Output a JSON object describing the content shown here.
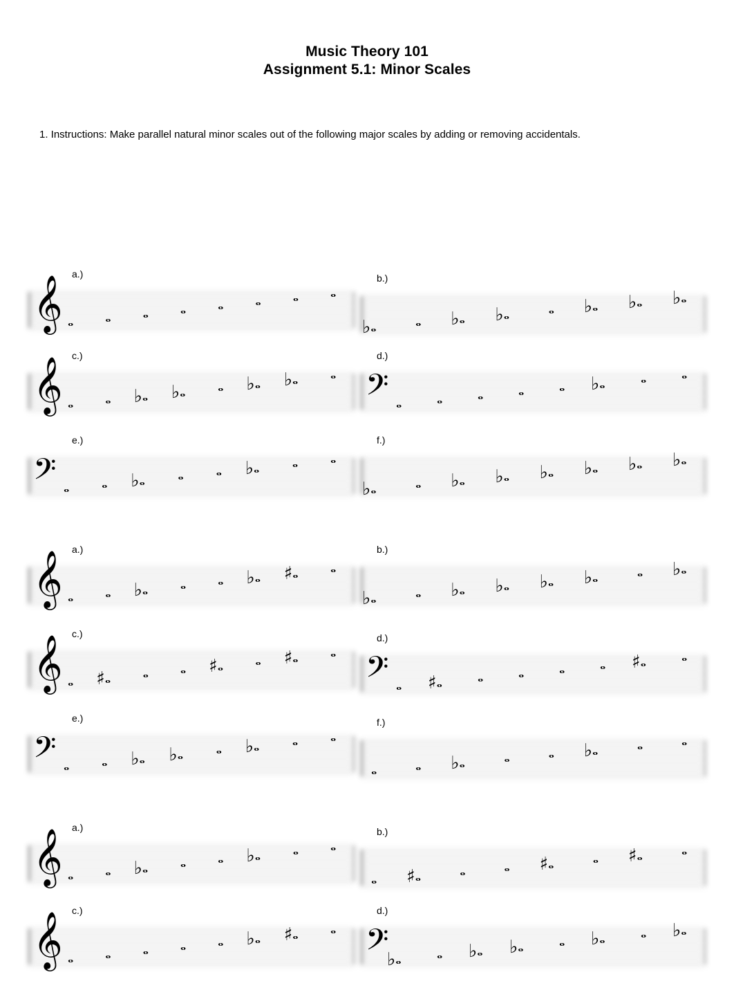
{
  "document": {
    "title_line_1": "Music Theory 101",
    "title_line_2": "Assignment 5.1: Minor Scales",
    "instructions": "1. Instructions: Make parallel natural minor scales out of the following major scales by adding or removing accidentals."
  },
  "glyphs": {
    "treble_clef": "𝄞",
    "bass_clef": "𝄢",
    "whole_note": "𝅝",
    "flat": "♭",
    "sharp": "♯",
    "natural": ""
  },
  "exercises": [
    {
      "block": 1,
      "label": "a.)",
      "clef": "treble",
      "notes": [
        {
          "accidental": "",
          "step": 0
        },
        {
          "accidental": "",
          "step": 1
        },
        {
          "accidental": "",
          "step": 2
        },
        {
          "accidental": "",
          "step": 3
        },
        {
          "accidental": "",
          "step": 4
        },
        {
          "accidental": "",
          "step": 5
        },
        {
          "accidental": "",
          "step": 6
        },
        {
          "accidental": "",
          "step": 7
        }
      ]
    },
    {
      "block": 1,
      "label": "b.)",
      "clef": "none",
      "notes": [
        {
          "accidental": "♭",
          "step": 0
        },
        {
          "accidental": "",
          "step": 1
        },
        {
          "accidental": "♭",
          "step": 2
        },
        {
          "accidental": "♭",
          "step": 3
        },
        {
          "accidental": "",
          "step": 4
        },
        {
          "accidental": "♭",
          "step": 5
        },
        {
          "accidental": "♭",
          "step": 6
        },
        {
          "accidental": "♭",
          "step": 7
        }
      ]
    },
    {
      "block": 1,
      "label": "c.)",
      "clef": "treble",
      "notes": [
        {
          "accidental": "",
          "step": 0
        },
        {
          "accidental": "",
          "step": 1
        },
        {
          "accidental": "♭",
          "step": 2
        },
        {
          "accidental": "♭",
          "step": 3
        },
        {
          "accidental": "",
          "step": 4
        },
        {
          "accidental": "♭",
          "step": 5
        },
        {
          "accidental": "♭",
          "step": 6
        },
        {
          "accidental": "",
          "step": 7
        }
      ]
    },
    {
      "block": 1,
      "label": "d.)",
      "clef": "bass",
      "notes": [
        {
          "accidental": "",
          "step": 0
        },
        {
          "accidental": "",
          "step": 1
        },
        {
          "accidental": "",
          "step": 2
        },
        {
          "accidental": "",
          "step": 3
        },
        {
          "accidental": "",
          "step": 4
        },
        {
          "accidental": "♭",
          "step": 5
        },
        {
          "accidental": "",
          "step": 6
        },
        {
          "accidental": "",
          "step": 7
        }
      ]
    },
    {
      "block": 1,
      "label": "e.)",
      "clef": "bass",
      "notes": [
        {
          "accidental": "",
          "step": 0
        },
        {
          "accidental": "",
          "step": 1
        },
        {
          "accidental": "♭",
          "step": 2
        },
        {
          "accidental": "",
          "step": 3
        },
        {
          "accidental": "",
          "step": 4
        },
        {
          "accidental": "♭",
          "step": 5
        },
        {
          "accidental": "",
          "step": 6
        },
        {
          "accidental": "",
          "step": 7
        }
      ]
    },
    {
      "block": 1,
      "label": "f.)",
      "clef": "none",
      "notes": [
        {
          "accidental": "♭",
          "step": 0
        },
        {
          "accidental": "",
          "step": 1
        },
        {
          "accidental": "♭",
          "step": 2
        },
        {
          "accidental": "♭",
          "step": 3
        },
        {
          "accidental": "♭",
          "step": 4
        },
        {
          "accidental": "♭",
          "step": 5
        },
        {
          "accidental": "♭",
          "step": 6
        },
        {
          "accidental": "♭",
          "step": 7
        }
      ]
    },
    {
      "block": 2,
      "label": "a.)",
      "clef": "treble",
      "notes": [
        {
          "accidental": "",
          "step": 0
        },
        {
          "accidental": "",
          "step": 1
        },
        {
          "accidental": "♭",
          "step": 2
        },
        {
          "accidental": "",
          "step": 3
        },
        {
          "accidental": "",
          "step": 4
        },
        {
          "accidental": "♭",
          "step": 5
        },
        {
          "accidental": "♯",
          "step": 6
        },
        {
          "accidental": "",
          "step": 7
        }
      ]
    },
    {
      "block": 2,
      "label": "b.)",
      "clef": "none",
      "notes": [
        {
          "accidental": "♭",
          "step": 0
        },
        {
          "accidental": "",
          "step": 1
        },
        {
          "accidental": "♭",
          "step": 2
        },
        {
          "accidental": "♭",
          "step": 3
        },
        {
          "accidental": "♭",
          "step": 4
        },
        {
          "accidental": "♭",
          "step": 5
        },
        {
          "accidental": "",
          "step": 6
        },
        {
          "accidental": "♭",
          "step": 7
        }
      ]
    },
    {
      "block": 2,
      "label": "c.)",
      "clef": "treble",
      "notes": [
        {
          "accidental": "",
          "step": 0
        },
        {
          "accidental": "♯",
          "step": 1
        },
        {
          "accidental": "",
          "step": 2
        },
        {
          "accidental": "",
          "step": 3
        },
        {
          "accidental": "♯",
          "step": 4
        },
        {
          "accidental": "",
          "step": 5
        },
        {
          "accidental": "♯",
          "step": 6
        },
        {
          "accidental": "",
          "step": 7
        }
      ]
    },
    {
      "block": 2,
      "label": "d.)",
      "clef": "bass",
      "notes": [
        {
          "accidental": "",
          "step": 0
        },
        {
          "accidental": "♯",
          "step": 1
        },
        {
          "accidental": "",
          "step": 2
        },
        {
          "accidental": "",
          "step": 3
        },
        {
          "accidental": "",
          "step": 4
        },
        {
          "accidental": "",
          "step": 5
        },
        {
          "accidental": "♯",
          "step": 6
        },
        {
          "accidental": "",
          "step": 7
        }
      ]
    },
    {
      "block": 2,
      "label": "e.)",
      "clef": "bass",
      "notes": [
        {
          "accidental": "",
          "step": 0
        },
        {
          "accidental": "",
          "step": 1
        },
        {
          "accidental": "♭",
          "step": 2
        },
        {
          "accidental": "♭",
          "step": 3
        },
        {
          "accidental": "",
          "step": 4
        },
        {
          "accidental": "♭",
          "step": 5
        },
        {
          "accidental": "",
          "step": 6
        },
        {
          "accidental": "",
          "step": 7
        }
      ]
    },
    {
      "block": 2,
      "label": "f.)",
      "clef": "none",
      "notes": [
        {
          "accidental": "",
          "step": 0
        },
        {
          "accidental": "",
          "step": 1
        },
        {
          "accidental": "♭",
          "step": 2
        },
        {
          "accidental": "",
          "step": 3
        },
        {
          "accidental": "",
          "step": 4
        },
        {
          "accidental": "♭",
          "step": 5
        },
        {
          "accidental": "",
          "step": 6
        },
        {
          "accidental": "",
          "step": 7
        }
      ]
    },
    {
      "block": 3,
      "label": "a.)",
      "clef": "treble",
      "notes": [
        {
          "accidental": "",
          "step": 0
        },
        {
          "accidental": "",
          "step": 1
        },
        {
          "accidental": "♭",
          "step": 2
        },
        {
          "accidental": "",
          "step": 3
        },
        {
          "accidental": "",
          "step": 4
        },
        {
          "accidental": "♭",
          "step": 5
        },
        {
          "accidental": "",
          "step": 6
        },
        {
          "accidental": "",
          "step": 7
        }
      ]
    },
    {
      "block": 3,
      "label": "b.)",
      "clef": "none",
      "notes": [
        {
          "accidental": "",
          "step": 0
        },
        {
          "accidental": "♯",
          "step": 1
        },
        {
          "accidental": "",
          "step": 2
        },
        {
          "accidental": "",
          "step": 3
        },
        {
          "accidental": "♯",
          "step": 4
        },
        {
          "accidental": "",
          "step": 5
        },
        {
          "accidental": "♯",
          "step": 6
        },
        {
          "accidental": "",
          "step": 7
        }
      ]
    },
    {
      "block": 3,
      "label": "c.)",
      "clef": "treble",
      "notes": [
        {
          "accidental": "",
          "step": 0
        },
        {
          "accidental": "",
          "step": 1
        },
        {
          "accidental": "",
          "step": 2
        },
        {
          "accidental": "",
          "step": 3
        },
        {
          "accidental": "",
          "step": 4
        },
        {
          "accidental": "♭",
          "step": 5
        },
        {
          "accidental": "♯",
          "step": 6
        },
        {
          "accidental": "",
          "step": 7
        }
      ]
    },
    {
      "block": 3,
      "label": "d.)",
      "clef": "bass",
      "notes": [
        {
          "accidental": "♭",
          "step": 0
        },
        {
          "accidental": "",
          "step": 1
        },
        {
          "accidental": "♭",
          "step": 2
        },
        {
          "accidental": "♭",
          "step": 3
        },
        {
          "accidental": "",
          "step": 4
        },
        {
          "accidental": "♭",
          "step": 5
        },
        {
          "accidental": "",
          "step": 6
        },
        {
          "accidental": "♭",
          "step": 7
        }
      ]
    }
  ]
}
